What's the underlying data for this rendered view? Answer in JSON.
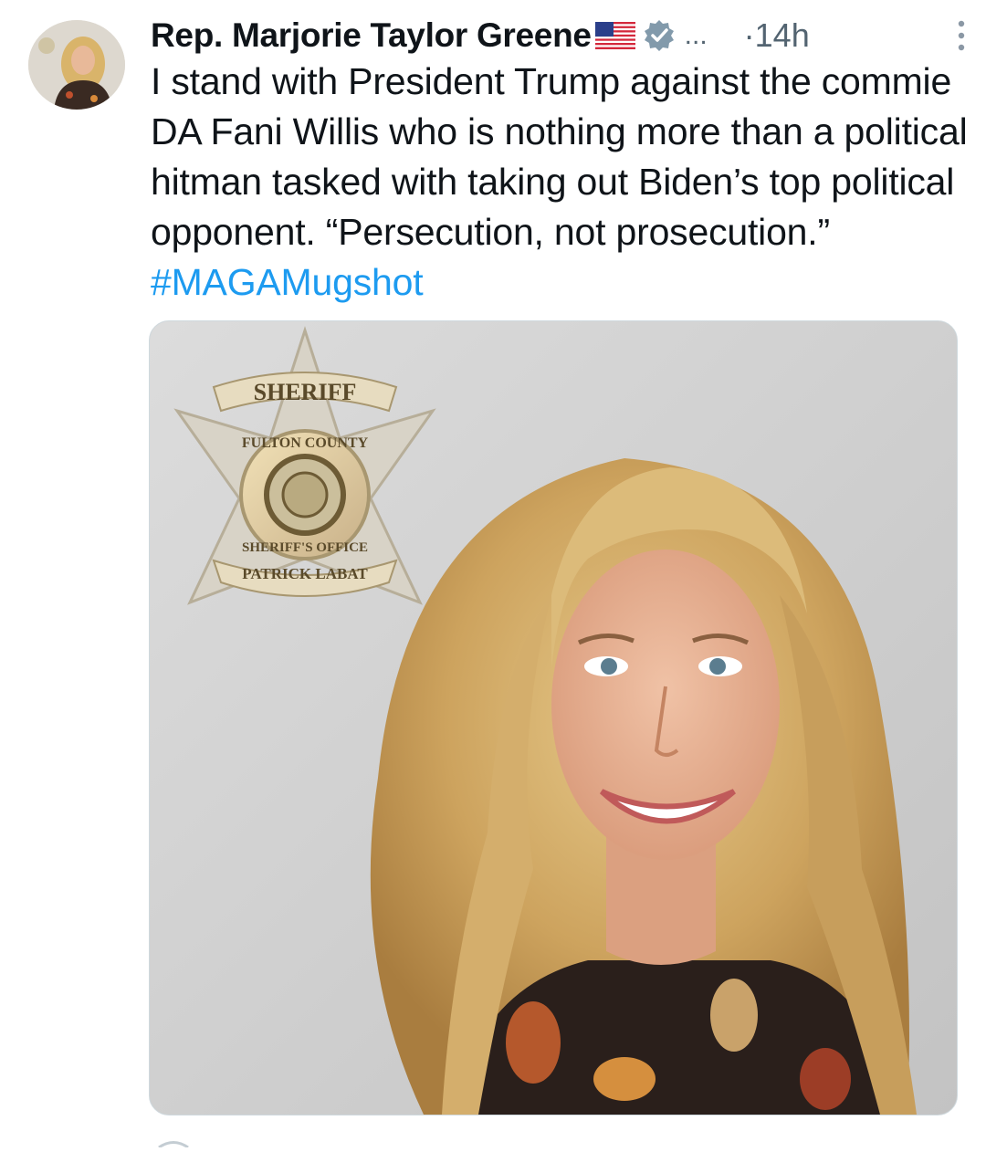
{
  "tweet": {
    "author_name": "Rep. Marjorie Taylor Greene",
    "flag_icon": "us-flag-icon",
    "verified_icon": "verified-badge-icon",
    "ellipsis": "...",
    "time": "·14h",
    "more_icon": "more-vertical-icon",
    "text_main": "I stand with President Trump against the commie DA Fani Willis who is nothing more than a political hitman tasked with taking out Biden’s top political opponent. “Persecution, not prosecution.” ",
    "hashtag": "#MAGAMugshot"
  },
  "media": {
    "badge_top": "SHERIFF",
    "badge_county": "FULTON COUNTY",
    "badge_office": "SHERIFF'S OFFICE",
    "badge_name": "PATRICK LABAT"
  },
  "colors": {
    "hashtag": "#1d9bf0",
    "muted": "#536471",
    "verified": "#829aab"
  }
}
